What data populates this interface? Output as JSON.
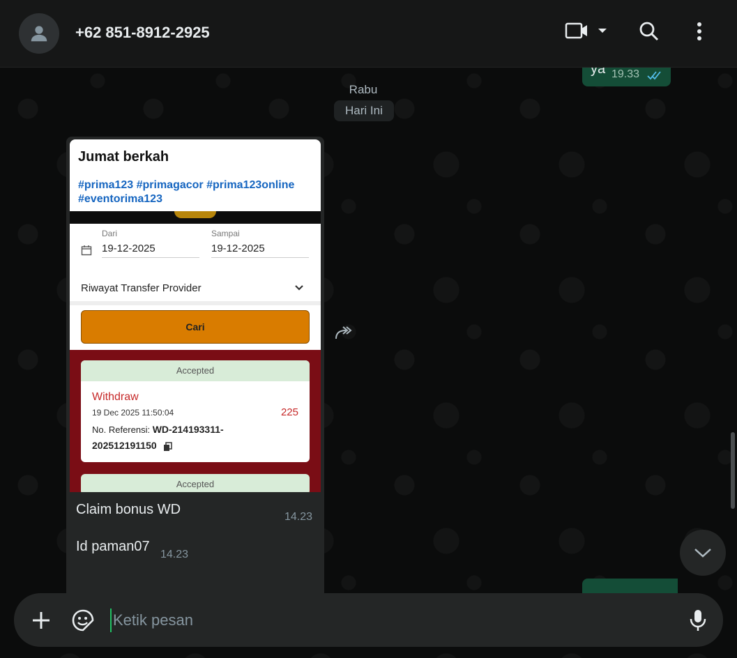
{
  "header": {
    "contact_name": "+62 851-8912-2925"
  },
  "messages": {
    "outgoing_top": {
      "text": "ya",
      "time": "19.33"
    },
    "date_labels": [
      "Rabu",
      "Hari Ini"
    ],
    "image_message": {
      "caption_title": "Jumat berkah",
      "hashtags": "#prima123 #primagacor #prima123online #eventorima123",
      "form": {
        "from_label": "Dari",
        "from_value": "19-12-2025",
        "to_label": "Sampai",
        "to_value": "19-12-2025",
        "dropdown": "Riwayat Transfer Provider",
        "search_button": "Cari"
      },
      "transactions": [
        {
          "status": "Accepted",
          "type": "Withdraw",
          "datetime": "19 Dec 2025 11:50:04",
          "amount": "225",
          "ref_label": "No. Referensi:",
          "ref_value": "WD-214193311-202512191150"
        },
        {
          "status": "Accepted"
        }
      ],
      "text": "Claim bonus WD",
      "time": "14.23"
    },
    "second_message": {
      "text": "Id paman07",
      "time": "14.23"
    }
  },
  "composer": {
    "placeholder": "Ketik pesan"
  },
  "icons": {
    "avatar": "person-icon",
    "video": "video-camera-icon",
    "search": "search-icon",
    "menu": "more-vertical-icon",
    "forward": "forward-icon",
    "add": "plus-icon",
    "sticker": "sticker-icon",
    "mic": "microphone-icon",
    "scroll": "chevron-down-icon"
  },
  "colors": {
    "outgoing_bubble": "#144d37",
    "incoming_bubble": "#242626",
    "read_ticks": "#53bdeb",
    "accent": "#21c063"
  }
}
